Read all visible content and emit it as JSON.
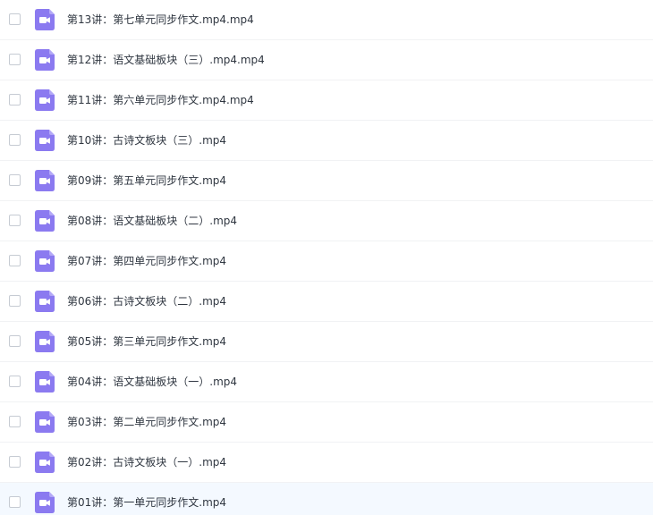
{
  "file_list": {
    "icon": "video-file-icon",
    "accent_color": "#8b7af0",
    "hover_row_color": "#f4f9ff",
    "items": [
      {
        "name": "第13讲：第七单元同步作文.mp4.mp4"
      },
      {
        "name": "第12讲：语文基础板块（三）.mp4.mp4"
      },
      {
        "name": "第11讲：第六单元同步作文.mp4.mp4"
      },
      {
        "name": "第10讲：古诗文板块（三）.mp4"
      },
      {
        "name": "第09讲：第五单元同步作文.mp4"
      },
      {
        "name": "第08讲：语文基础板块（二）.mp4"
      },
      {
        "name": "第07讲：第四单元同步作文.mp4"
      },
      {
        "name": "第06讲：古诗文板块（二）.mp4"
      },
      {
        "name": "第05讲：第三单元同步作文.mp4"
      },
      {
        "name": "第04讲：语文基础板块（一）.mp4"
      },
      {
        "name": "第03讲：第二单元同步作文.mp4"
      },
      {
        "name": "第02讲：古诗文板块（一）.mp4"
      },
      {
        "name": "第01讲：第一单元同步作文.mp4"
      }
    ]
  }
}
